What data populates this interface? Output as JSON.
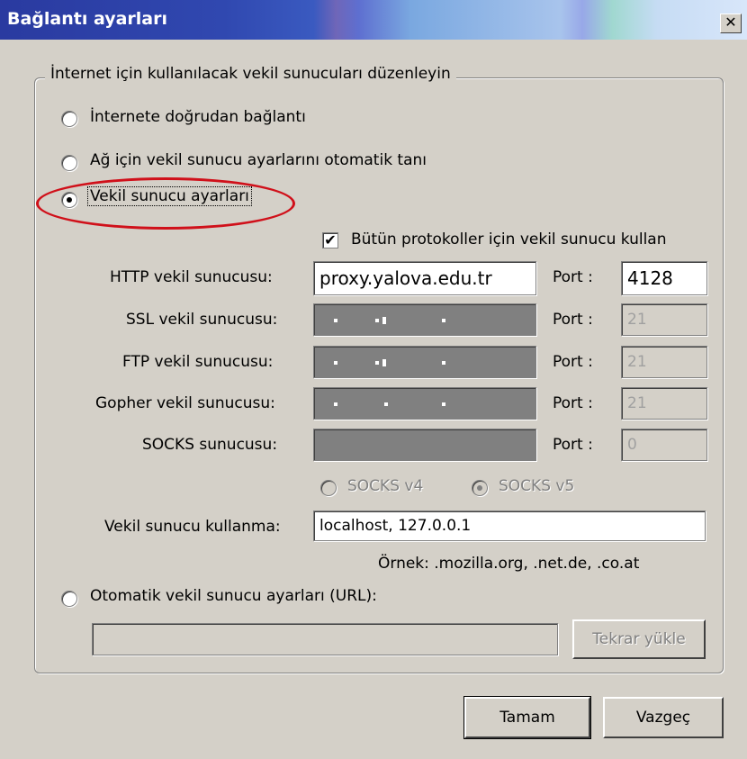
{
  "window": {
    "title": "Bağlantı ayarları",
    "close_label": "✕"
  },
  "group": {
    "legend": "İnternet için kullanılacak vekil sunucuları düzenleyin"
  },
  "options": {
    "direct": "İnternete doğrudan bağlantı",
    "auto_detect": "Ağ için vekil sunucu ayarlarını otomatik tanı",
    "manual": "Vekil sunucu ayarları",
    "auto_url": "Otomatik vekil sunucu ayarları (URL):"
  },
  "selected_option": "manual",
  "use_for_all": {
    "label": "Bütün protokoller için vekil sunucu kullan",
    "checked": true
  },
  "proxies": {
    "http": {
      "label": "HTTP vekil sunucusu:",
      "value": "proxy.yalova.edu.tr",
      "port_label": "Port :",
      "port": "4128"
    },
    "ssl": {
      "label": "SSL vekil sunucusu:",
      "port_label": "Port :",
      "port": "21"
    },
    "ftp": {
      "label": "FTP vekil sunucusu:",
      "port_label": "Port :",
      "port": "21"
    },
    "gopher": {
      "label": "Gopher vekil sunucusu:",
      "port_label": "Port :",
      "port": "21"
    },
    "socks": {
      "label": "SOCKS sunucusu:",
      "port_label": "Port :",
      "port": "0"
    }
  },
  "socks_versions": {
    "v4": "SOCKS v4",
    "v5": "SOCKS v5",
    "selected": "v5"
  },
  "no_proxy": {
    "label": "Vekil sunucu kullanma:",
    "value": "localhost, 127.0.0.1",
    "example": "Örnek: .mozilla.org, .net.de, .co.at"
  },
  "auto_url_field": {
    "value": ""
  },
  "buttons": {
    "reload": "Tekrar yükle",
    "ok": "Tamam",
    "cancel": "Vazgeç"
  },
  "colors": {
    "highlight_ellipse": "#d0101a",
    "title_bar": "#2a3aa0"
  }
}
